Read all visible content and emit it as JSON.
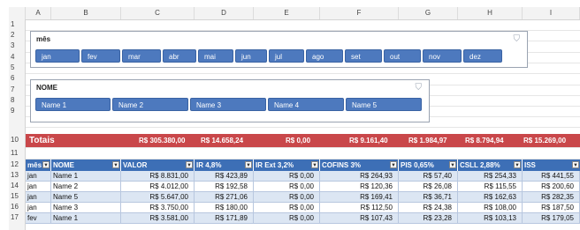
{
  "columns": [
    "A",
    "B",
    "C",
    "D",
    "E",
    "F",
    "G",
    "H",
    "I"
  ],
  "rows": [
    "1",
    "2",
    "3",
    "4",
    "5",
    "6",
    "7",
    "8",
    "9",
    "10",
    "11",
    "12",
    "13",
    "14",
    "15",
    "16",
    "17"
  ],
  "slicer_mes": {
    "title": "mês",
    "items": [
      "jan",
      "fev",
      "mar",
      "abr",
      "mai",
      "jun",
      "jul",
      "ago",
      "set",
      "out",
      "nov",
      "dez"
    ]
  },
  "slicer_nome": {
    "title": "NOME",
    "items": [
      "Name 1",
      "Name 2",
      "Name 3",
      "Name 4",
      "Name 5"
    ]
  },
  "totals": {
    "label": "Totais",
    "values": [
      "R$ 305.380,00",
      "R$ 14.658,24",
      "R$ 0,00",
      "R$ 9.161,40",
      "R$ 1.984,97",
      "R$ 8.794,94",
      "R$ 15.269,00"
    ]
  },
  "table": {
    "headers": [
      "mês",
      "NOME",
      "VALOR",
      "IR 4,8%",
      "IR Ext 3,2%",
      "COFINS 3%",
      "PIS 0,65%",
      "CSLL 2,88%",
      "ISS"
    ],
    "rows": [
      [
        "jan",
        "Name 1",
        "R$ 8.831,00",
        "R$ 423,89",
        "R$ 0,00",
        "R$ 264,93",
        "R$ 57,40",
        "R$ 254,33",
        "R$ 441,55"
      ],
      [
        "jan",
        "Name 2",
        "R$ 4.012,00",
        "R$ 192,58",
        "R$ 0,00",
        "R$ 120,36",
        "R$ 26,08",
        "R$ 115,55",
        "R$ 200,60"
      ],
      [
        "jan",
        "Name 5",
        "R$ 5.647,00",
        "R$ 271,06",
        "R$ 0,00",
        "R$ 169,41",
        "R$ 36,71",
        "R$ 162,63",
        "R$ 282,35"
      ],
      [
        "jan",
        "Name 3",
        "R$ 3.750,00",
        "R$ 180,00",
        "R$ 0,00",
        "R$ 112,50",
        "R$ 24,38",
        "R$ 108,00",
        "R$ 187,50"
      ],
      [
        "fev",
        "Name 1",
        "R$ 3.581,00",
        "R$ 171,89",
        "R$ 0,00",
        "R$ 107,43",
        "R$ 23,28",
        "R$ 103,13",
        "R$ 179,05"
      ]
    ]
  }
}
